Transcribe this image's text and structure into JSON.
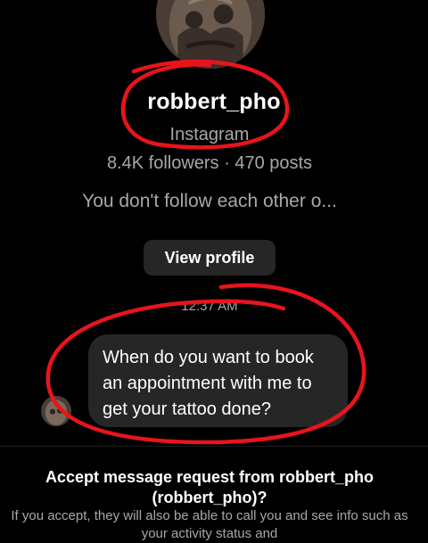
{
  "profile": {
    "username": "robbert_pho",
    "platform": "Instagram",
    "stats": "8.4K followers · 470 posts",
    "follow_note": "You don't follow each other o...",
    "view_profile_label": "View profile"
  },
  "conversation": {
    "timestamp": "12:37 AM",
    "messages": [
      {
        "text": "When do you want to book an appointment with me to get your tattoo done?"
      }
    ]
  },
  "message_request": {
    "title": "Accept message request from robbert_pho (robbert_pho)?",
    "body": "If you accept, they will also be able to call you and see info such as your activity status and"
  },
  "annotation": {
    "color": "#e8141c"
  }
}
